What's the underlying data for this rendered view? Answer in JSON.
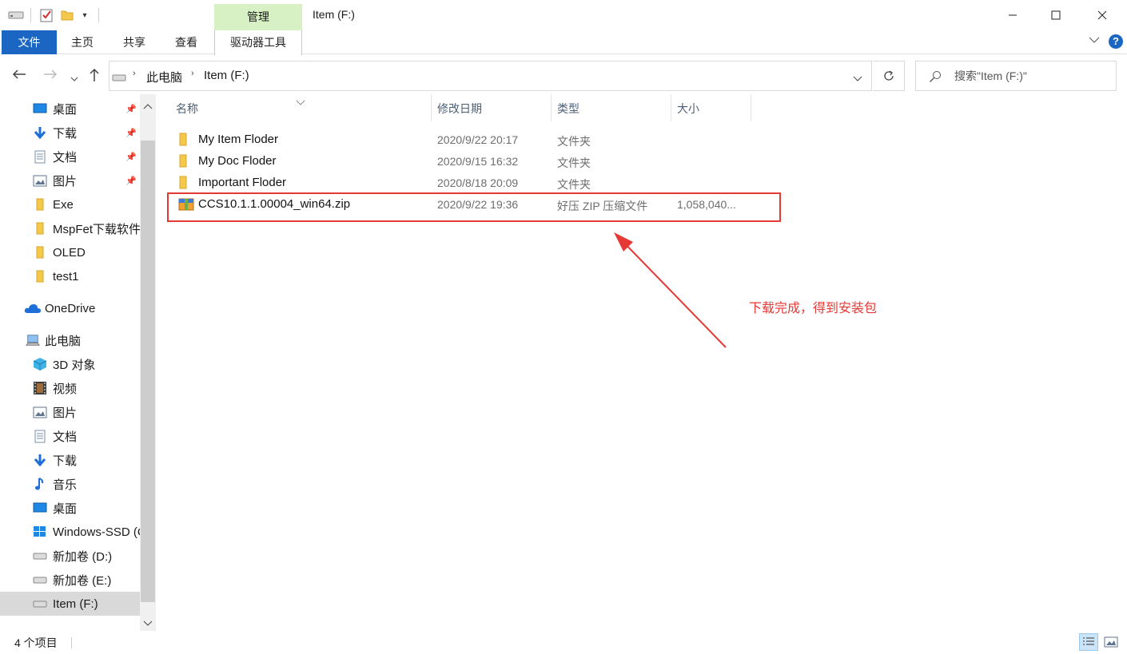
{
  "window": {
    "title": "Item (F:)"
  },
  "ribbon": {
    "context_group": "管理",
    "tabs": [
      "文件",
      "主页",
      "共享",
      "查看",
      "驱动器工具"
    ]
  },
  "address": {
    "breadcrumb": [
      "此电脑",
      "Item (F:)"
    ],
    "search_placeholder": "搜索\"Item (F:)\""
  },
  "nav": {
    "quick_access": [
      {
        "label": "桌面",
        "icon": "desktop-icon",
        "pinned": true
      },
      {
        "label": "下载",
        "icon": "download-icon",
        "pinned": true
      },
      {
        "label": "文档",
        "icon": "documents-icon",
        "pinned": true
      },
      {
        "label": "图片",
        "icon": "pictures-icon",
        "pinned": true
      },
      {
        "label": "Exe",
        "icon": "folder-icon"
      },
      {
        "label": "MspFet下载软件",
        "icon": "folder-icon"
      },
      {
        "label": "OLED",
        "icon": "folder-icon"
      },
      {
        "label": "test1",
        "icon": "folder-icon"
      }
    ],
    "onedrive": "OneDrive",
    "this_pc": "此电脑",
    "pc_items": [
      {
        "label": "3D 对象",
        "icon": "3d-objects-icon"
      },
      {
        "label": "视频",
        "icon": "videos-icon"
      },
      {
        "label": "图片",
        "icon": "pictures-icon"
      },
      {
        "label": "文档",
        "icon": "documents-icon"
      },
      {
        "label": "下载",
        "icon": "download-icon"
      },
      {
        "label": "音乐",
        "icon": "music-icon"
      },
      {
        "label": "桌面",
        "icon": "desktop-icon"
      },
      {
        "label": "Windows-SSD (C:)",
        "icon": "windows-drive-icon"
      },
      {
        "label": "新加卷 (D:)",
        "icon": "drive-icon"
      },
      {
        "label": "新加卷 (E:)",
        "icon": "drive-icon"
      },
      {
        "label": "Item (F:)",
        "icon": "drive-icon",
        "selected": true
      }
    ]
  },
  "columns": {
    "name": "名称",
    "modified": "修改日期",
    "type": "类型",
    "size": "大小"
  },
  "files": [
    {
      "name": "My Item Floder",
      "modified": "2020/9/22 20:17",
      "type": "文件夹",
      "size": "",
      "icon": "folder-icon"
    },
    {
      "name": "My Doc Floder",
      "modified": "2020/9/15 16:32",
      "type": "文件夹",
      "size": "",
      "icon": "folder-icon"
    },
    {
      "name": "Important Floder",
      "modified": "2020/8/18 20:09",
      "type": "文件夹",
      "size": "",
      "icon": "folder-icon"
    },
    {
      "name": "CCS10.1.1.00004_win64.zip",
      "modified": "2020/9/22 19:36",
      "type": "好压 ZIP 压缩文件",
      "size": "1,058,040...",
      "icon": "zip-archive-icon"
    }
  ],
  "annotation": {
    "text": "下载完成，得到安装包",
    "color": "#e53935"
  },
  "status": {
    "item_count": "4 个项目"
  },
  "colors": {
    "accent": "#1a66c2",
    "context_tab": "#d7f0c4",
    "annotation": "#e53935",
    "selected": "#d9d9d9"
  }
}
